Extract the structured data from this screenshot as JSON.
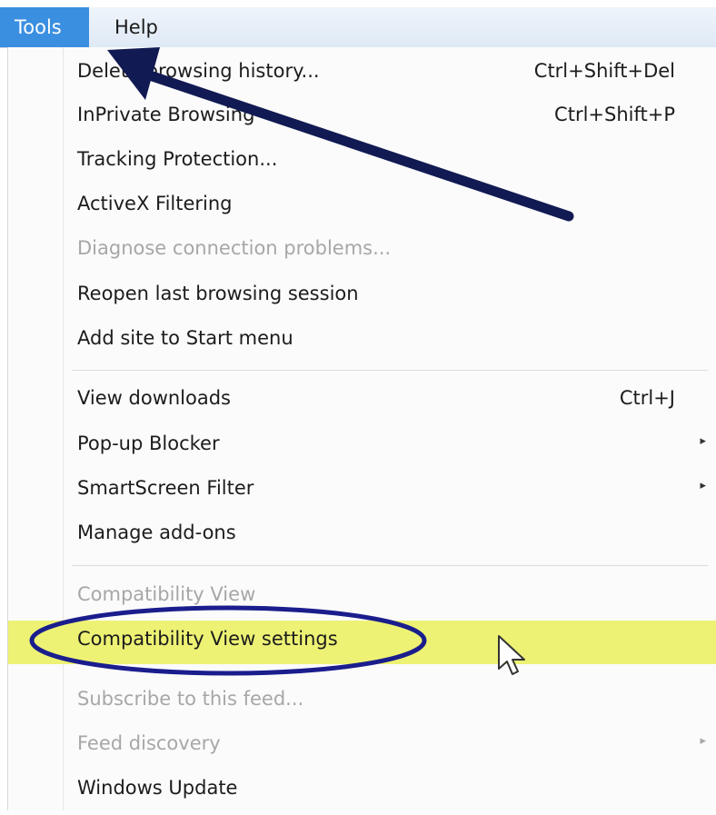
{
  "menubar": {
    "items": [
      {
        "label": "Tools"
      },
      {
        "label": "Help"
      }
    ]
  },
  "menu": {
    "items": [
      {
        "label": "Delete browsing history...",
        "shortcut": "Ctrl+Shift+Del"
      },
      {
        "label": "InPrivate Browsing",
        "shortcut": "Ctrl+Shift+P"
      },
      {
        "label": "Tracking Protection..."
      },
      {
        "label": "ActiveX Filtering"
      },
      {
        "label": "Diagnose connection problems...",
        "disabled": true
      },
      {
        "label": "Reopen last browsing session"
      },
      {
        "label": "Add site to Start menu"
      },
      {
        "label": "View downloads",
        "shortcut": "Ctrl+J"
      },
      {
        "label": "Pop-up Blocker",
        "submenu": true
      },
      {
        "label": "SmartScreen Filter",
        "submenu": true
      },
      {
        "label": "Manage add-ons"
      },
      {
        "label": "Compatibility View",
        "disabled": true
      },
      {
        "label": "Compatibility View settings",
        "highlighted": true
      },
      {
        "label": "Subscribe to this feed...",
        "disabled": true
      },
      {
        "label": "Feed discovery",
        "disabled": true,
        "submenu": true
      },
      {
        "label": "Windows Update"
      }
    ],
    "submenu_arrow_glyph": "▸"
  },
  "colors": {
    "active_menu": "#3b8fe0",
    "highlight": "#edf274",
    "annotation": "#1a1d8c",
    "arrow": "#111a52"
  },
  "annotations": {
    "arrow": "pointer-arrow toward Tools menu",
    "circle": "circle around Compatibility View settings"
  }
}
